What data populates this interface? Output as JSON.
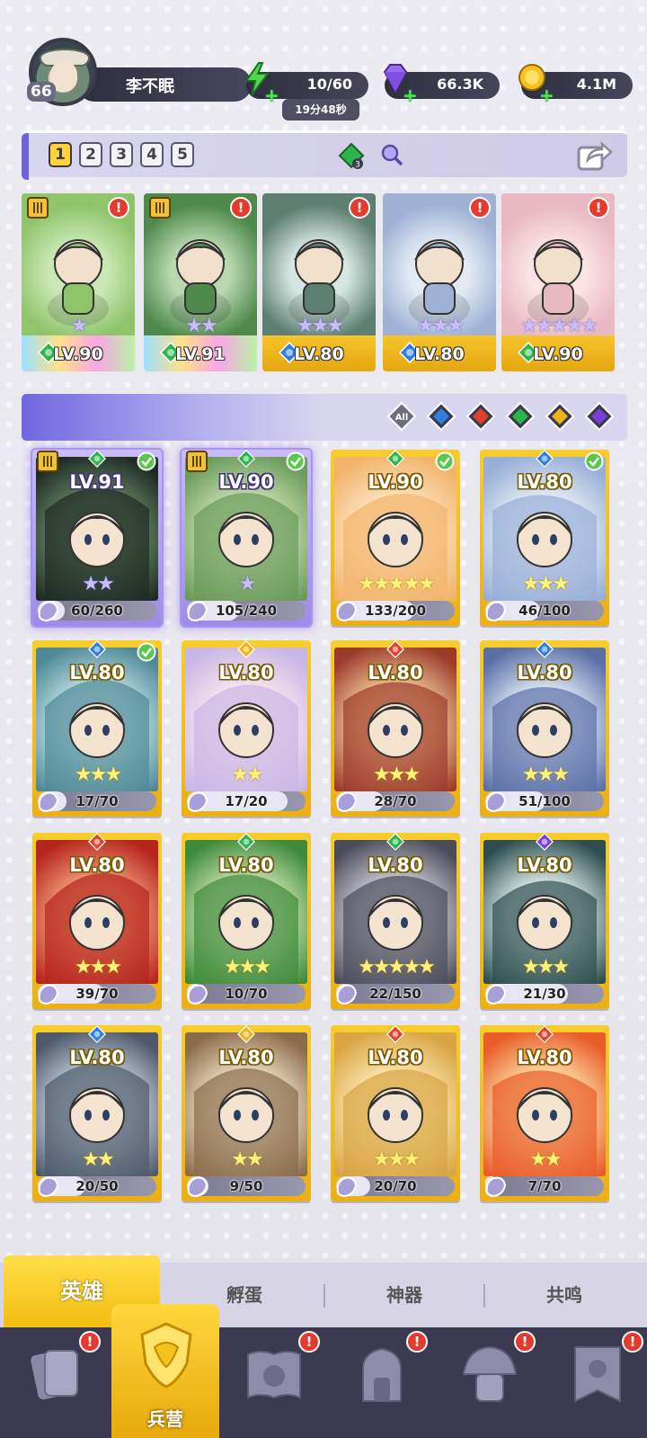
{
  "player": {
    "level": "66",
    "name": "李不眠"
  },
  "resources": {
    "energy": "10/60",
    "energy_timer": "19分48秒",
    "gems": "66.3K",
    "gold": "4.1M"
  },
  "team_tabs": [
    "1",
    "2",
    "3",
    "4",
    "5"
  ],
  "team_active": "1",
  "team_icon_count": "3",
  "team": [
    {
      "level": "LV.90",
      "element": "wind",
      "stars": "★",
      "frame": "rainbow",
      "alert": "!"
    },
    {
      "level": "LV.91",
      "element": "wind",
      "stars": "★★",
      "frame": "rainbow",
      "alert": "!"
    },
    {
      "level": "LV.80",
      "element": "water",
      "stars": "★★★",
      "frame": "gold",
      "alert": "!"
    },
    {
      "level": "LV.80",
      "element": "water",
      "stars": "★★★",
      "frame": "gold",
      "alert": "!"
    },
    {
      "level": "LV.90",
      "element": "wind",
      "stars": "★★★★★",
      "frame": "gold",
      "alert": "!"
    }
  ],
  "filters": [
    "All",
    "water",
    "fire",
    "wind",
    "light",
    "dark"
  ],
  "heroes": [
    {
      "level": "LV.91",
      "element": "wind",
      "frag": "60/260",
      "ratio": 0.23,
      "stars": "★★",
      "style": "purple",
      "check": true,
      "rank": true
    },
    {
      "level": "LV.90",
      "element": "wind",
      "frag": "105/240",
      "ratio": 0.44,
      "stars": "★",
      "style": "purple",
      "check": true,
      "rank": true
    },
    {
      "level": "LV.90",
      "element": "wind",
      "frag": "133/200",
      "ratio": 0.66,
      "stars": "★★★★★",
      "style": "gold",
      "check": true,
      "rank": false
    },
    {
      "level": "LV.80",
      "element": "water",
      "frag": "46/100",
      "ratio": 0.46,
      "stars": "★★★",
      "style": "gold",
      "check": true,
      "rank": false
    },
    {
      "level": "LV.80",
      "element": "water",
      "frag": "17/70",
      "ratio": 0.24,
      "stars": "★★★",
      "style": "gold",
      "check": true,
      "rank": false
    },
    {
      "level": "LV.80",
      "element": "light",
      "frag": "17/20",
      "ratio": 0.85,
      "stars": "★★",
      "style": "gold",
      "check": false,
      "rank": false
    },
    {
      "level": "LV.80",
      "element": "fire",
      "frag": "28/70",
      "ratio": 0.4,
      "stars": "★★★",
      "style": "gold",
      "check": false,
      "rank": false
    },
    {
      "level": "LV.80",
      "element": "water",
      "frag": "51/100",
      "ratio": 0.51,
      "stars": "★★★",
      "style": "gold",
      "check": false,
      "rank": false
    },
    {
      "level": "LV.80",
      "element": "fire",
      "frag": "39/70",
      "ratio": 0.56,
      "stars": "★★★",
      "style": "gold",
      "check": false,
      "rank": false
    },
    {
      "level": "LV.80",
      "element": "wind",
      "frag": "10/70",
      "ratio": 0.14,
      "stars": "★★★",
      "style": "gold",
      "check": false,
      "rank": false
    },
    {
      "level": "LV.80",
      "element": "wind",
      "frag": "22/150",
      "ratio": 0.15,
      "stars": "★★★★★",
      "style": "gold",
      "check": false,
      "rank": false
    },
    {
      "level": "LV.80",
      "element": "dark",
      "frag": "21/30",
      "ratio": 0.7,
      "stars": "★★★",
      "style": "gold",
      "check": false,
      "rank": false
    },
    {
      "level": "LV.80",
      "element": "water",
      "frag": "20/50",
      "ratio": 0.4,
      "stars": "★★",
      "style": "gold",
      "check": false,
      "rank": false
    },
    {
      "level": "LV.80",
      "element": "light",
      "frag": "9/50",
      "ratio": 0.18,
      "stars": "★★",
      "style": "gold",
      "check": false,
      "rank": false
    },
    {
      "level": "LV.80",
      "element": "fire",
      "frag": "20/70",
      "ratio": 0.29,
      "stars": "★★★",
      "style": "gold",
      "check": false,
      "rank": false
    },
    {
      "level": "LV.80",
      "element": "fire",
      "frag": "7/70",
      "ratio": 0.1,
      "stars": "★★",
      "style": "gold",
      "check": false,
      "rank": false
    }
  ],
  "subtabs": {
    "heroes": "英雄",
    "hatch": "孵蛋",
    "artifacts": "神器",
    "resonance": "共鸣"
  },
  "nav": {
    "barracks": "兵营",
    "alert": "!"
  },
  "colors": {
    "water": "#2f7fe0",
    "fire": "#e2402a",
    "wind": "#2bb54a",
    "light": "#f1b21c",
    "dark": "#7a3fd6",
    "gold_card": "#f4c21c",
    "purple_card": "#b7a8f4"
  }
}
